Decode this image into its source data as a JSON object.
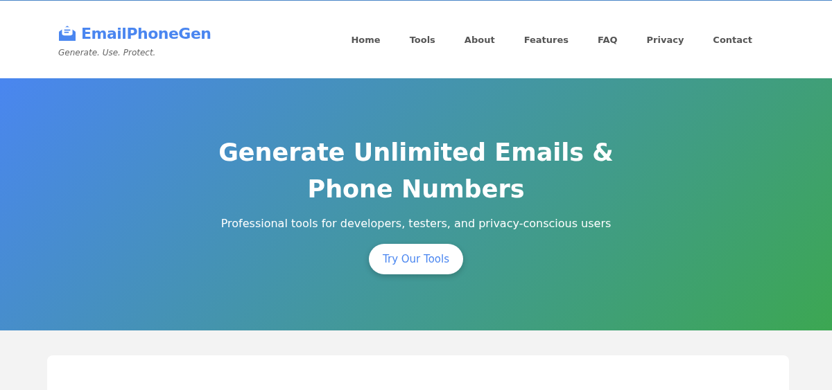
{
  "brand": {
    "name": "EmailPhoneGen",
    "tagline": "Generate. Use. Protect."
  },
  "nav": [
    "Home",
    "Tools",
    "About",
    "Features",
    "FAQ",
    "Privacy",
    "Contact"
  ],
  "hero": {
    "title": "Generate Unlimited Emails & Phone Numbers",
    "subtitle": "Professional tools for developers, testers, and privacy-conscious users",
    "button": "Try Our Tools"
  }
}
